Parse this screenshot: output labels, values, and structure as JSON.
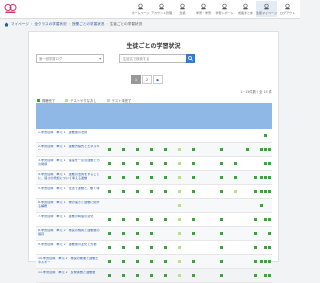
{
  "app": {
    "logo": "school-logo"
  },
  "nav": [
    {
      "label": "ホームページ",
      "icon": "home-icon"
    },
    {
      "label": "アカウント管理",
      "icon": "user-icon"
    },
    {
      "label": "生徒",
      "icon": "people-icon"
    },
    {
      "label": "学習・学習",
      "icon": "book-icon"
    },
    {
      "label": "学習レポート",
      "icon": "chart-icon"
    },
    {
      "label": "成長まとめ",
      "icon": "graph-icon"
    },
    {
      "label": "生徒マイページ",
      "icon": "mypage-icon",
      "active": true
    },
    {
      "label": "ログアウト",
      "icon": "logout-icon"
    }
  ],
  "breadcrumb": [
    "マイページ",
    "全クラスの学習状況",
    "授業ごとの学習状況",
    "生徒ごとの学習状況"
  ],
  "page": {
    "title": "生徒ごとの学習状況",
    "filter_placeholder": "第一回学習ログ",
    "search_placeholder": "生徒名で検索する",
    "pages": [
      "1",
      "2",
      "▶"
    ],
    "count": "1~15件数 / 全 15 件",
    "legend": [
      {
        "label": "視聴完了",
        "color": "#3aa63a"
      },
      {
        "label": "テストやりなおし",
        "color": "#b6e08a"
      },
      {
        "label": "テスト未完了",
        "color": "#cfcfcf"
      }
    ]
  },
  "rows": [
    {
      "label": "1.学習目標　単元 1　運動量の法則",
      "cells": [
        0,
        0,
        0,
        0,
        0,
        0,
        0,
        0,
        0,
        0,
        0,
        0,
        0,
        1,
        0,
        0
      ]
    },
    {
      "label": "2.学習目標　単元 1　運動方程式とエネルギー",
      "cells": [
        1,
        1,
        1,
        1,
        1,
        2,
        1,
        0,
        1,
        0,
        1,
        0,
        1,
        1,
        1,
        1
      ]
    },
    {
      "label": "3.学習目標　単元 1　速度を一定な運動と力の関係",
      "cells": [
        1,
        1,
        1,
        1,
        1,
        2,
        1,
        0,
        1,
        1,
        0,
        0,
        0,
        1,
        1,
        1
      ]
    },
    {
      "label": "4.学習目標　単元 1　運動の法則をすることに、速さの増加について考える運動",
      "cells": [
        1,
        1,
        1,
        1,
        1,
        2,
        1,
        0,
        1,
        1,
        0,
        1,
        1,
        1,
        1,
        1
      ]
    },
    {
      "label": "5.学習目標　単元 1　位置で運動と、動く球",
      "cells": [
        1,
        1,
        1,
        1,
        1,
        2,
        1,
        0,
        1,
        2,
        0,
        1,
        1,
        1,
        1,
        1
      ]
    },
    {
      "label": "6.学習目標　単元 1　物の速さと運動に関する解釈",
      "cells": [
        0,
        0,
        0,
        0,
        0,
        2,
        0,
        0,
        0,
        0,
        0,
        0,
        1,
        0,
        0,
        1
      ]
    },
    {
      "label": "7.学習目標　単元 1　運動の時間の変化",
      "cells": [
        1,
        1,
        1,
        1,
        1,
        2,
        1,
        0,
        1,
        0,
        0,
        1,
        0,
        1,
        1,
        1
      ]
    },
    {
      "label": "8.学習目標　単元 2　衝突の規則と運動量の保存",
      "cells": [
        1,
        1,
        1,
        1,
        0,
        2,
        1,
        0,
        1,
        0,
        0,
        1,
        0,
        0,
        1,
        1
      ]
    },
    {
      "label": "9.学習目標　単元 2　運動量の変化と力積",
      "cells": [
        1,
        1,
        1,
        1,
        1,
        2,
        0,
        0,
        1,
        0,
        0,
        1,
        0,
        1,
        1,
        1
      ]
    },
    {
      "label": "10.学習目標　単元 2　衝突の前後と運動エネルギー",
      "cells": [
        1,
        1,
        1,
        1,
        1,
        2,
        1,
        0,
        1,
        0,
        0,
        1,
        1,
        1,
        1,
        1
      ]
    },
    {
      "label": "11.学習目標　単元 2　反発係数と運動量",
      "cells": [
        1,
        1,
        1,
        1,
        1,
        2,
        1,
        0,
        1,
        0,
        0,
        1,
        0,
        1,
        1,
        1
      ]
    }
  ]
}
